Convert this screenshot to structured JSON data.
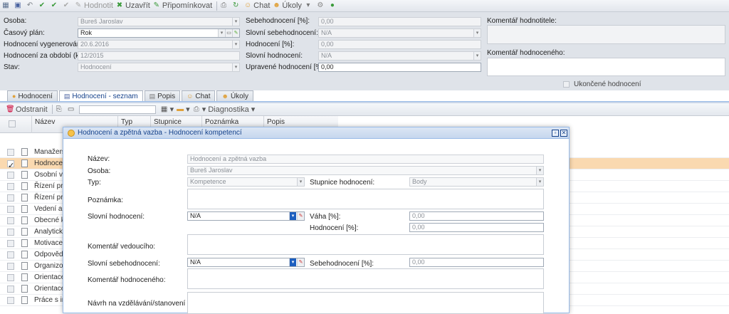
{
  "toolbar": {
    "items": [
      {
        "name": "grid-icon",
        "label": ""
      },
      {
        "name": "save-icon",
        "label": ""
      },
      {
        "name": "undo-icon",
        "label": ""
      },
      {
        "name": "check-icon",
        "label": ""
      },
      {
        "name": "check-circle-icon",
        "label": ""
      },
      {
        "name": "check-disabled-icon",
        "label": ""
      },
      {
        "name": "evaluate",
        "label": "Hodnotit"
      },
      {
        "name": "close-eval",
        "label": "Uzavřít"
      },
      {
        "name": "comment",
        "label": "Připomínkovat"
      },
      {
        "name": "print-icon",
        "label": ""
      },
      {
        "name": "refresh-icon",
        "label": ""
      },
      {
        "name": "chat",
        "label": "Chat"
      },
      {
        "name": "tasks",
        "label": "Úkoly"
      },
      {
        "name": "dropdown-icon",
        "label": ""
      },
      {
        "name": "gear-icon",
        "label": ""
      },
      {
        "name": "help-icon",
        "label": ""
      }
    ]
  },
  "form": {
    "osoba_label": "Osoba:",
    "osoba_value": "Bureš Jaroslav",
    "plan_label": "Časový plán:",
    "plan_value": "Rok",
    "generated_label": "Hodnocení vygenerováno:",
    "generated_value": "20.6.2016",
    "period_label": "Hodnocení za období (k):",
    "period_value": "12/2015",
    "stav_label": "Stav:",
    "stav_value": "Hodnocení",
    "self_pct_label": "Sebehodnocení [%]:",
    "self_pct_value": "0,00",
    "self_verbal_label": "Slovní sebehodnocení:",
    "self_verbal_value": "N/A",
    "eval_pct_label": "Hodnocení [%]:",
    "eval_pct_value": "0,00",
    "verbal_label": "Slovní hodnocení:",
    "verbal_value": "N/A",
    "adjusted_label": "Upravené hodnocení [%]:",
    "adjusted_value": "0,00",
    "evaluator_comment_label": "Komentář hodnotitele:",
    "evaluated_comment_label": "Komentář hodnoceného:",
    "finished_label": "Ukončené hodnocení"
  },
  "tabs": [
    {
      "label": "Hodnocení"
    },
    {
      "label": "Hodnocení - seznam"
    },
    {
      "label": "Popis"
    },
    {
      "label": "Chat"
    },
    {
      "label": "Úkoly"
    }
  ],
  "gridtoolbar": {
    "delete_label": "Odstranit",
    "diag_label": "Diagnostika"
  },
  "grid": {
    "headers": [
      "Název",
      "Typ",
      "Stupnice",
      "Poznámka",
      "Popis"
    ],
    "rows": [
      "Manažerské",
      "Hodnocení a",
      "Osobní vůdc",
      "Řízení proce",
      "Řízení proje",
      "Vedení a říz",
      "Obecné kom",
      "Analytické m",
      "Motivace a",
      "Odpovědnos",
      "Organizova",
      "Orientace n",
      "Orientace n",
      "Práce s inf"
    ]
  },
  "dialog": {
    "title": "Hodnocení a zpětná vazba - Hodnocení kompetencí",
    "name_label": "Název:",
    "name_value": "Hodnocení a zpětná vazba",
    "osoba_label": "Osoba:",
    "osoba_value": "Bureš Jaroslav",
    "typ_label": "Typ:",
    "typ_value": "Kompetence",
    "scale_label": "Stupnice hodnocení:",
    "scale_value": "Body",
    "note_label": "Poznámka:",
    "verbal_label": "Slovní hodnocení:",
    "verbal_value": "N/A",
    "weight_label": "Váha [%]:",
    "weight_value": "0,00",
    "pct_label": "Hodnocení [%]:",
    "pct_value": "0,00",
    "lead_comment_label": "Komentář vedoucího:",
    "self_verbal_label": "Slovní sebehodnocení:",
    "self_verbal_value": "N/A",
    "self_pct_label": "Sebehodnocení [%]:",
    "self_pct_value": "0,00",
    "evaluated_comment_label": "Komentář hodnoceného:",
    "training_label": "Návrh na vzdělávání/stanovení cílů:"
  }
}
